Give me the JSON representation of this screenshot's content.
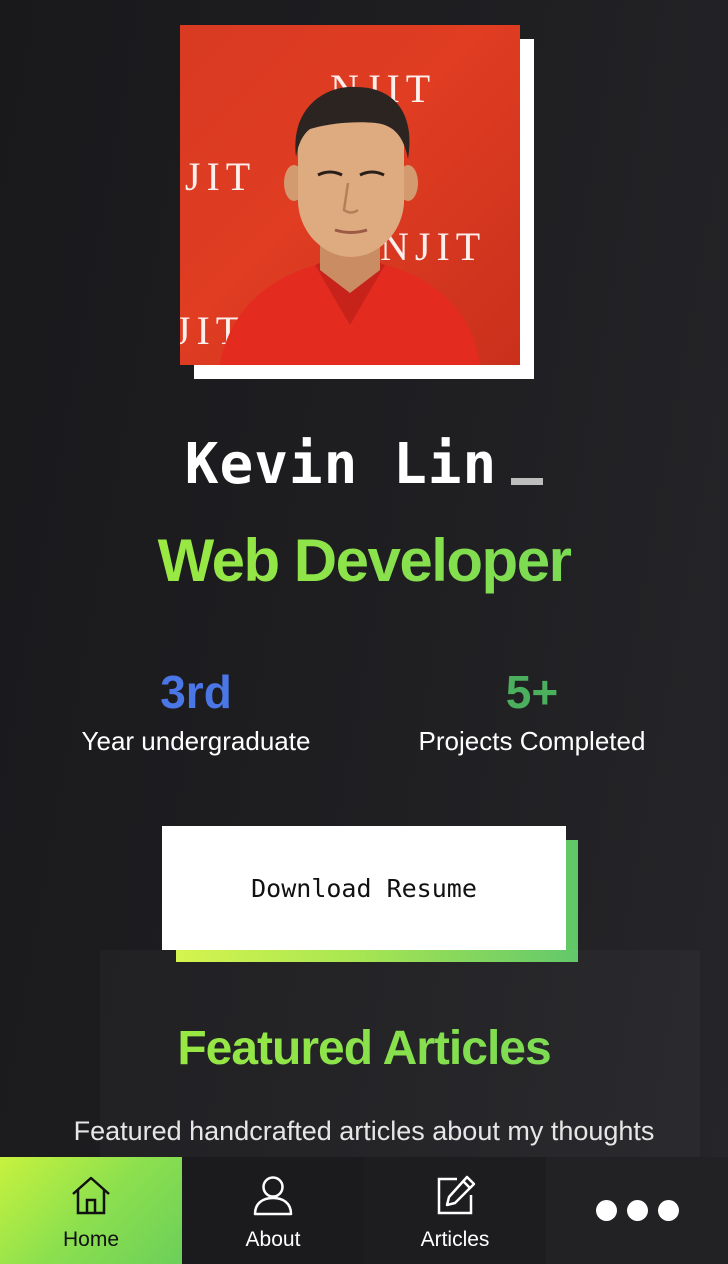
{
  "profile": {
    "name": "Kevin Lin",
    "role": "Web Developer",
    "photo_watermark": "NJIT"
  },
  "stats": [
    {
      "value": "3rd",
      "label": "Year undergraduate"
    },
    {
      "value": "5+",
      "label": "Projects Completed"
    }
  ],
  "resume": {
    "button_label": "Download Resume"
  },
  "featured": {
    "title": "Featured Articles",
    "subtitle": "Featured handcrafted articles about my thoughts"
  },
  "nav": {
    "items": [
      {
        "label": "Home",
        "icon": "home-icon",
        "active": true
      },
      {
        "label": "About",
        "icon": "user-icon",
        "active": false
      },
      {
        "label": "Articles",
        "icon": "edit-icon",
        "active": false
      },
      {
        "label": "",
        "icon": "more-icon",
        "active": false
      }
    ]
  },
  "colors": {
    "accent_green": "#8fe04a",
    "stat_blue": "#4a76e6",
    "stat_green": "#4caf5e",
    "background": "#1b1b1e"
  }
}
